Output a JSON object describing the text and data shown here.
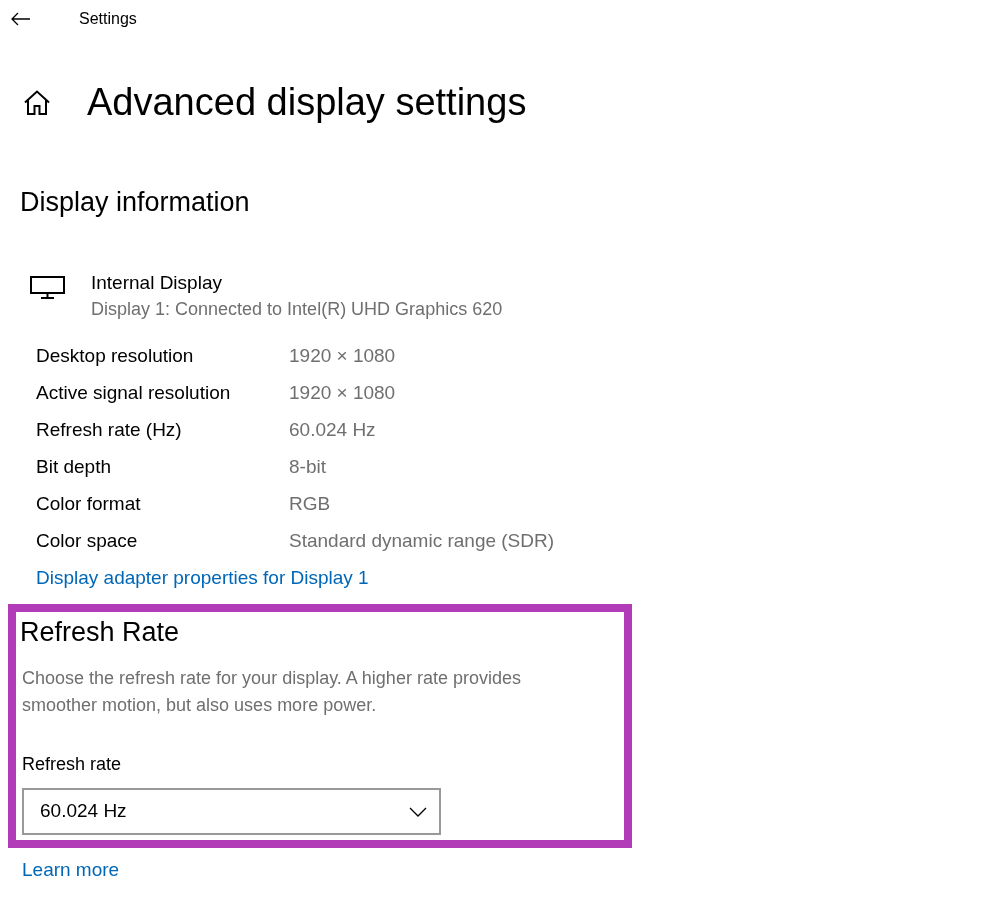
{
  "window": {
    "title": "Settings"
  },
  "page": {
    "title": "Advanced display settings"
  },
  "display_information": {
    "heading": "Display information",
    "display": {
      "name": "Internal Display",
      "description": "Display 1: Connected to Intel(R) UHD Graphics 620"
    },
    "properties": [
      {
        "label": "Desktop resolution",
        "value": "1920 × 1080"
      },
      {
        "label": "Active signal resolution",
        "value": "1920 × 1080"
      },
      {
        "label": "Refresh rate (Hz)",
        "value": "60.024 Hz"
      },
      {
        "label": "Bit depth",
        "value": "8-bit"
      },
      {
        "label": "Color format",
        "value": "RGB"
      },
      {
        "label": "Color space",
        "value": "Standard dynamic range (SDR)"
      }
    ],
    "link": "Display adapter properties for Display 1"
  },
  "refresh_rate": {
    "highlighted": true,
    "heading": "Refresh Rate",
    "description": "Choose the refresh rate for your display. A higher rate provides smoother motion, but also uses more power.",
    "field_label": "Refresh rate",
    "dropdown": {
      "value": "60.024 Hz"
    },
    "link": "Learn more"
  }
}
